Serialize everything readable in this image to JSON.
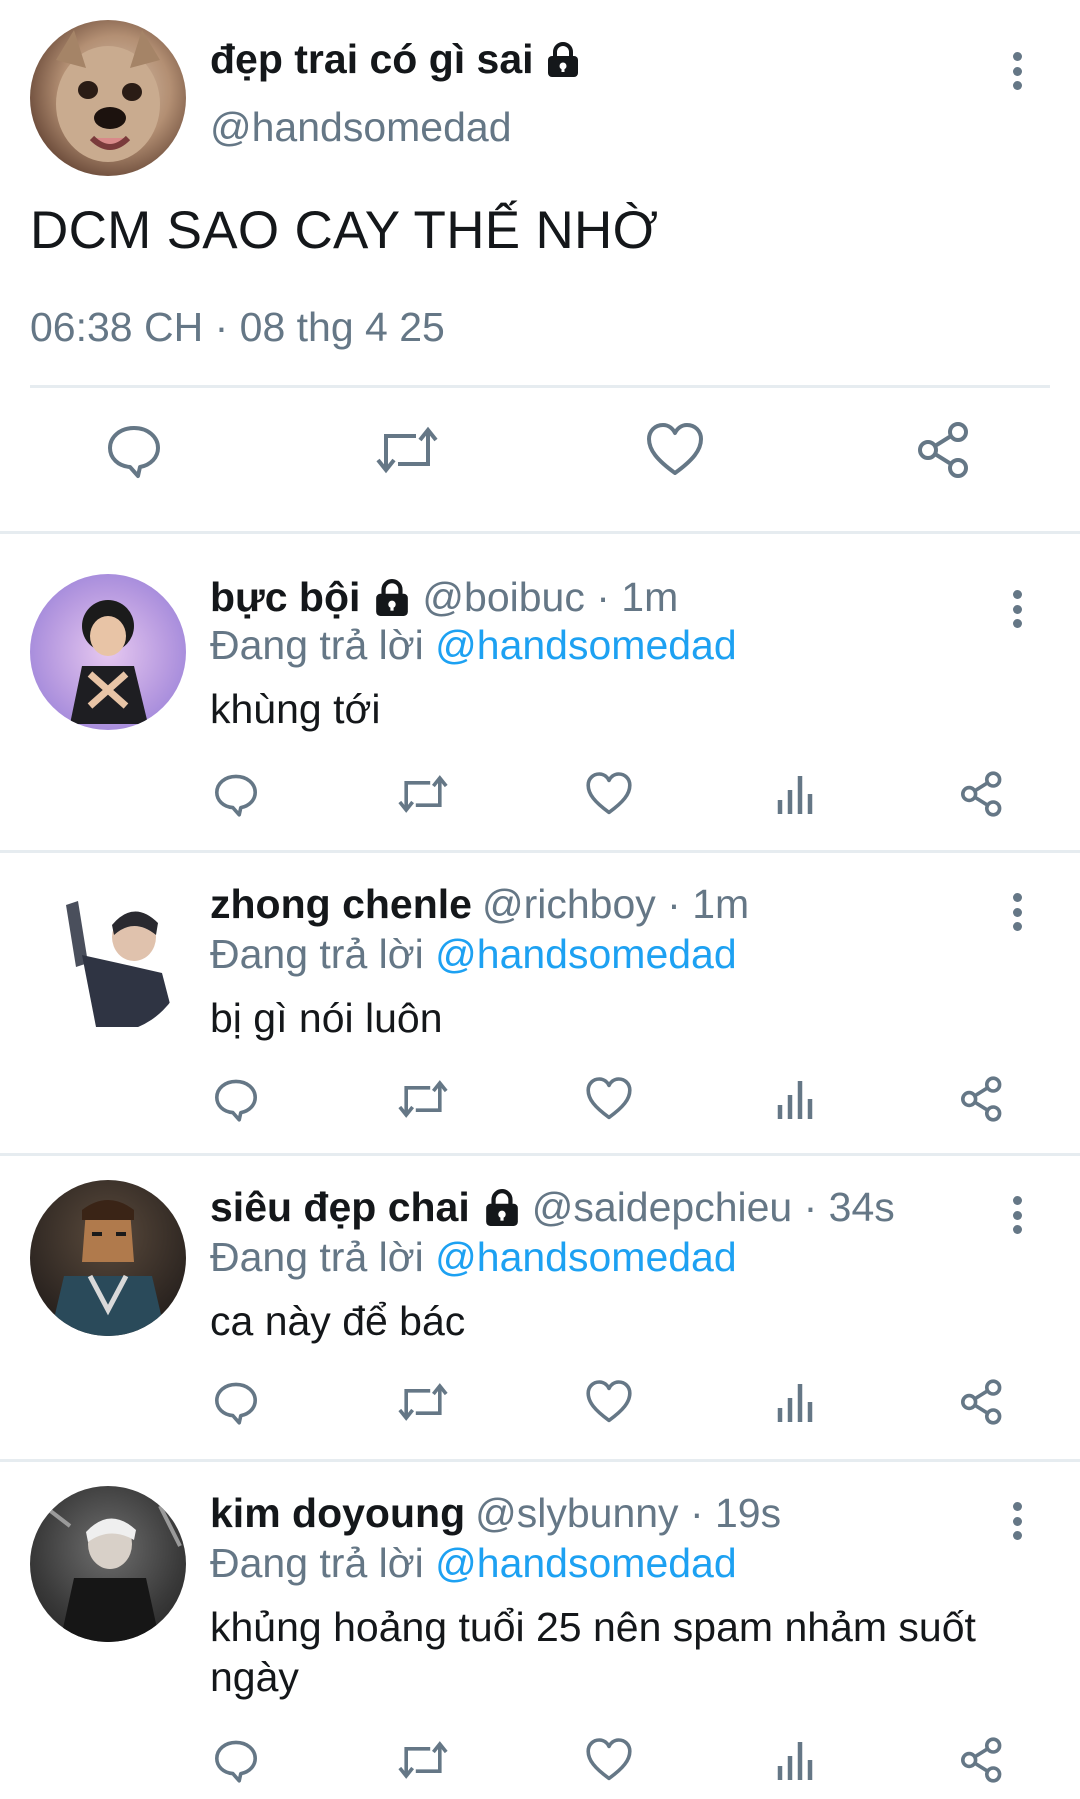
{
  "main_tweet": {
    "author_name": "đẹp trai có gì sai",
    "author_handle": "@handsomedad",
    "text": "DCM SAO CAY THẾ NHỜ",
    "timestamp": "06:38 CH · 08 thg 4 25",
    "actions": [
      "reply-icon",
      "retweet-icon",
      "like-icon",
      "share-icon"
    ]
  },
  "replies": [
    {
      "name": "bực bội",
      "locked": true,
      "meta": "@boibuc · 1m",
      "replying_prefix": "Đang trả lời",
      "replying_to": "@handsomedad",
      "text": "khùng tới"
    },
    {
      "name": "zhong chenle",
      "locked": false,
      "meta": "@richboy · 1m",
      "replying_prefix": "Đang trả lời",
      "replying_to": "@handsomedad",
      "text": "bị gì nói luôn"
    },
    {
      "name": "siêu đẹp chai",
      "locked": true,
      "meta": "@saidepchieu · 34s",
      "replying_prefix": "Đang trả lời",
      "replying_to": "@handsomedad",
      "text": "ca này để bác"
    },
    {
      "name": "kim doyoung",
      "locked": false,
      "meta": "@slybunny · 19s",
      "replying_prefix": "Đang trả lời",
      "replying_to": "@handsomedad",
      "text": "khủng hoảng tuổi 25 nên spam nhảm suốt ngày"
    }
  ],
  "reply_actions": [
    "reply-icon",
    "retweet-icon",
    "like-icon",
    "analytics-icon",
    "share-icon"
  ],
  "colors": {
    "link": "#1da1f2",
    "secondary_text": "#657786",
    "divider": "#e6ecf0"
  }
}
